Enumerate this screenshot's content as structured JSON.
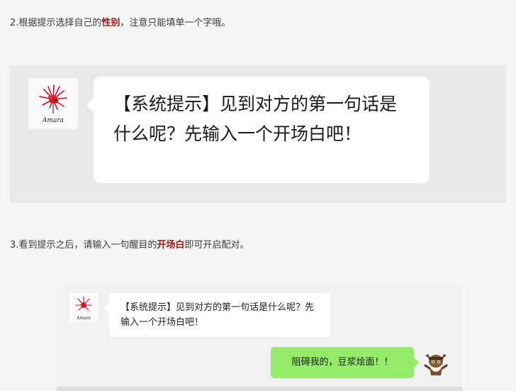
{
  "steps": {
    "step2": {
      "prefix": "2.根据提示选择自己的",
      "highlight": "性别",
      "suffix": "，注意只能填单一个字哦。"
    },
    "step3": {
      "prefix": "3.看到提示之后，请输入一句醒目的",
      "highlight": "开场白",
      "suffix": "即可开启配对。"
    }
  },
  "chat1": {
    "avatar_icon": "red-spider-lily-avatar-icon",
    "avatar_caption": "Amara",
    "message": "【系统提示】见到对方的第一句话是什么呢？先输入一个开场白吧！"
  },
  "chat2": {
    "system_avatar_icon": "red-spider-lily-avatar-icon",
    "system_avatar_caption": "Amara",
    "system_message": "【系统提示】见到对方的第一句话是什么呢？先输入一个开场白吧！",
    "user_message": "阻碍我的，豆浆烩面！！",
    "user_avatar_icon": "cartoon-character-avatar-icon"
  },
  "colors": {
    "highlight": "#a31515",
    "user_bubble": "#95ec69",
    "system_bubble": "#ffffff"
  }
}
